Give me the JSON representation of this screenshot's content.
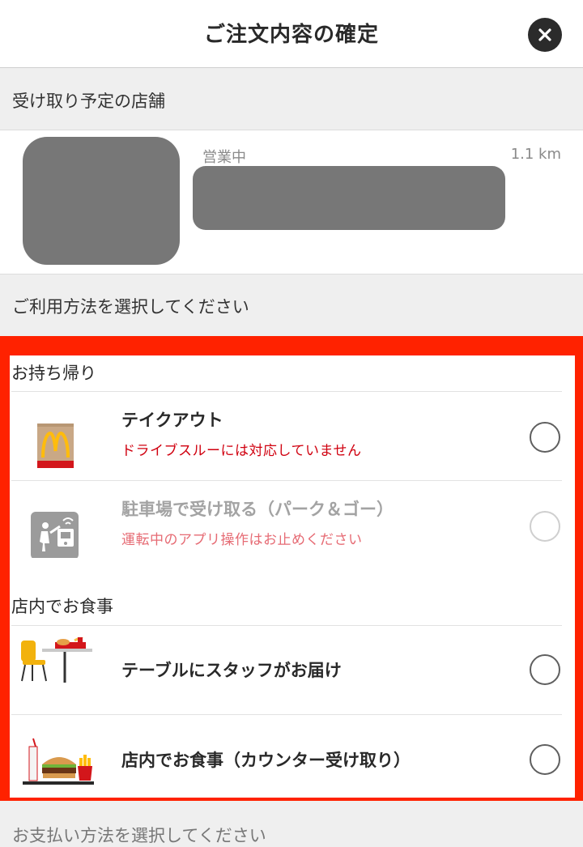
{
  "header": {
    "title": "ご注文内容の確定",
    "close_icon": "close-icon"
  },
  "store_section": {
    "heading": "受け取り予定の店舗",
    "status": "営業中",
    "distance": "1.1 km"
  },
  "usage_section": {
    "heading": "ご利用方法を選択してください",
    "groups": [
      {
        "label": "お持ち帰り",
        "options": [
          {
            "title": "テイクアウト",
            "note": "ドライブスルーには対応していません",
            "icon": "takeout-bag-icon",
            "enabled": true,
            "selected": false
          },
          {
            "title": "駐車場で受け取る（パーク＆ゴー）",
            "note": "運転中のアプリ操作はお止めください",
            "icon": "park-and-go-icon",
            "enabled": false,
            "selected": false
          }
        ]
      },
      {
        "label": "店内でお食事",
        "options": [
          {
            "title": "テーブルにスタッフがお届け",
            "icon": "table-delivery-icon",
            "enabled": true,
            "selected": false
          },
          {
            "title": "店内でお食事（カウンター受け取り）",
            "icon": "counter-meal-icon",
            "enabled": true,
            "selected": false
          }
        ]
      }
    ]
  },
  "payment_section": {
    "heading": "お支払い方法を選択してください"
  },
  "colors": {
    "highlight": "#ff2200",
    "warning_text": "#d0000f",
    "disabled_warning_text": "#e66b74",
    "placeholder_gray": "#777777"
  }
}
